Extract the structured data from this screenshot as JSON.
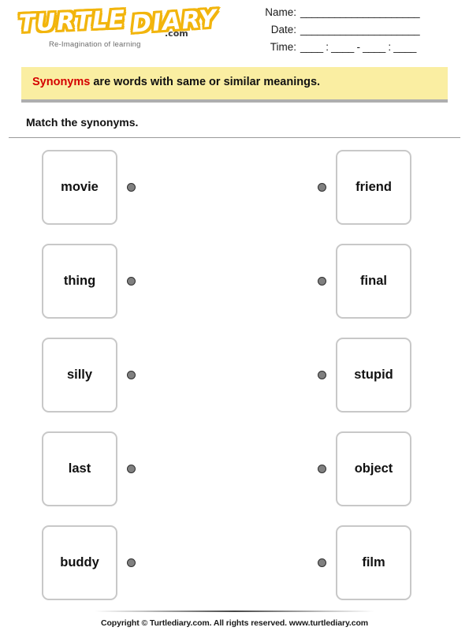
{
  "brand": {
    "logo_word1": "TURTLE",
    "logo_word2": "DIARY",
    "logo_suffix": ".com",
    "tagline": "Re-Imagination of learning"
  },
  "header": {
    "fields": [
      {
        "label": "Name:",
        "value": "_____________________"
      },
      {
        "label": "Date:",
        "value": "_____________________"
      },
      {
        "label": "Time:",
        "value": "____ : ____ - ____ : ____"
      }
    ]
  },
  "banner": {
    "keyword": "Synonyms",
    "text": " are words with same or similar meanings.",
    "background_color": "#FAEEA2",
    "keyword_color": "#D40000"
  },
  "instruction": {
    "text": "Match the synonyms."
  },
  "match": {
    "dot_color": "#808080",
    "box_border_color": "#C8C8C8",
    "rows": [
      {
        "left": "movie",
        "right": "friend"
      },
      {
        "left": "thing",
        "right": "final"
      },
      {
        "left": "silly",
        "right": "stupid"
      },
      {
        "left": "last",
        "right": "object"
      },
      {
        "left": "buddy",
        "right": "film"
      }
    ]
  },
  "footer": {
    "copyright": "Copyright © Turtlediary.com. All rights reserved. www.turtlediary.com"
  }
}
